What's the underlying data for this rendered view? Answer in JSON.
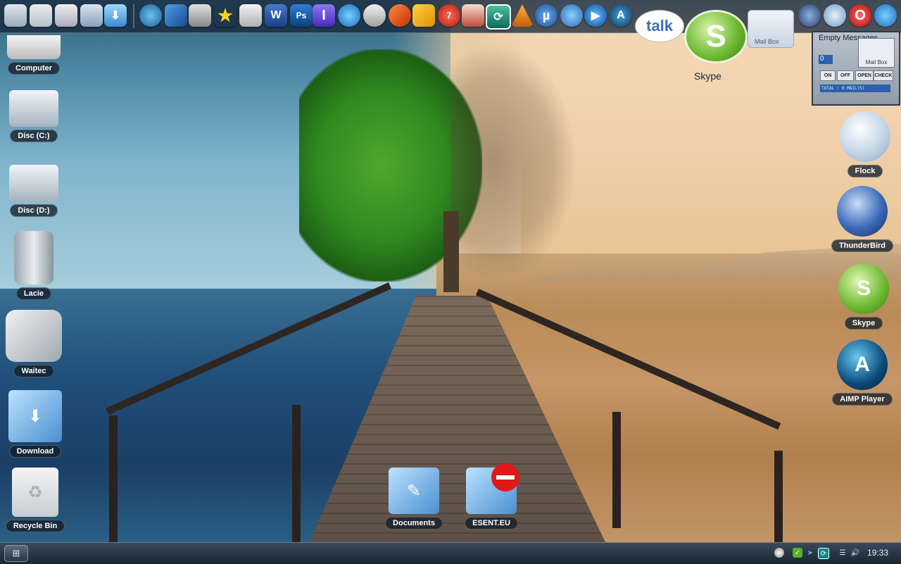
{
  "desktop_left": [
    {
      "label": "Computer",
      "icon": "laptop-icon"
    },
    {
      "label": "Disc (C:)",
      "icon": "hard-disk-icon"
    },
    {
      "label": "Disc (D:)",
      "icon": "hard-disk-icon"
    },
    {
      "label": "Lacie",
      "icon": "external-drive-icon"
    },
    {
      "label": "Waitec",
      "icon": "usb-drive-icon"
    },
    {
      "label": "Download",
      "icon": "download-folder-icon"
    },
    {
      "label": "Recycle Bin",
      "icon": "recycle-bin-icon"
    }
  ],
  "desktop_right": [
    {
      "label": "Flock",
      "icon": "flock-icon"
    },
    {
      "label": "ThunderBird",
      "icon": "thunderbird-icon"
    },
    {
      "label": "Skype",
      "icon": "skype-icon"
    },
    {
      "label": "AIMP Player",
      "icon": "aimp-icon"
    }
  ],
  "desktop_bottom": [
    {
      "label": "Documents",
      "icon": "documents-folder-icon"
    },
    {
      "label": "ESENT.EU",
      "icon": "blocked-folder-icon"
    }
  ],
  "top_widgets": {
    "talk_text": "talk",
    "skype_letter": "S",
    "skype_label": "Skype",
    "mailbox_label": "Mail Box"
  },
  "mail_widget": {
    "title": "Empty Messages",
    "count": "0",
    "mailbox_label": "Mail Box",
    "buttons": [
      "ON",
      "OFF",
      "OPEN",
      "CHECK"
    ],
    "total": "TOTAL : 0 MAIL(S)"
  },
  "dock": {
    "icons": [
      "computer-icon",
      "recycle-bin-icon",
      "drawing-icon",
      "disk-icon",
      "download-icon",
      "globe-icon",
      "bird-icon",
      "dice-icon",
      "star-icon",
      "calculator-icon",
      "word-icon",
      "photoshop-icon",
      "text-icon",
      "ie-icon",
      "magnifier-icon",
      "scissors-icon",
      "puzzle-icon",
      "seven-icon",
      "hat-icon",
      "sync-icon",
      "vlc-icon",
      "utorrent-icon",
      "quicktime-icon",
      "media-play-icon",
      "aimp-icon"
    ],
    "right_icons": [
      "thunderbird-icon",
      "flock-icon",
      "opera-icon",
      "ie-icon"
    ],
    "dock_letters": {
      "word": "W",
      "photoshop": "Ps",
      "text": "I",
      "utorrent": "µ",
      "opera": "O",
      "seven": "7"
    }
  },
  "taskbar": {
    "clock": "19:33",
    "tray_icons": [
      "orb-icon",
      "skype-tray-icon",
      "network-icon",
      "sync-tray-icon",
      "updates-icon",
      "volume-icon"
    ]
  }
}
